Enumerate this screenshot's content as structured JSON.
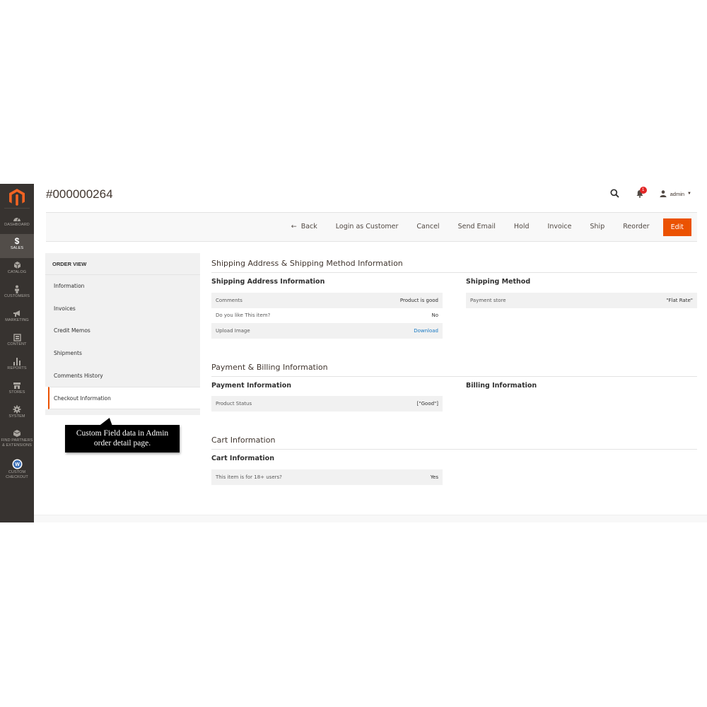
{
  "sidebar": {
    "items": [
      {
        "label": "DASHBOARD",
        "icon": "dashboard-icon"
      },
      {
        "label": "SALES",
        "icon": "dollar-icon",
        "active": true
      },
      {
        "label": "CATALOG",
        "icon": "cube-icon"
      },
      {
        "label": "CUSTOMERS",
        "icon": "person-icon"
      },
      {
        "label": "MARKETING",
        "icon": "megaphone-icon"
      },
      {
        "label": "CONTENT",
        "icon": "content-icon"
      },
      {
        "label": "REPORTS",
        "icon": "bar-chart-icon"
      },
      {
        "label": "STORES",
        "icon": "store-icon"
      },
      {
        "label": "SYSTEM",
        "icon": "gear-icon"
      },
      {
        "label_line1": "FIND PARTNERS",
        "label_line2": "& EXTENSIONS",
        "icon": "box-icon"
      },
      {
        "label_line1": "CUSTOM",
        "label_line2": "CHECKOUT",
        "icon": "w-logo-icon"
      }
    ]
  },
  "header": {
    "title": "#000000264",
    "notification_count": "1",
    "user": "admin"
  },
  "toolbar": {
    "back": "Back",
    "login_as_customer": "Login as Customer",
    "cancel": "Cancel",
    "send_email": "Send Email",
    "hold": "Hold",
    "invoice": "Invoice",
    "ship": "Ship",
    "reorder": "Reorder",
    "edit": "Edit"
  },
  "tabs": {
    "title": "ORDER VIEW",
    "items": [
      "Information",
      "Invoices",
      "Credit Memos",
      "Shipments",
      "Comments History",
      "Checkout Information"
    ]
  },
  "annotation": {
    "line1": "Custom Field data in Admin",
    "line2": "order detail page."
  },
  "shipping": {
    "section_title": "Shipping Address & Shipping Method Information",
    "address_title": "Shipping Address Information",
    "address_rows": [
      {
        "k": "Comments",
        "v": "Product is good"
      },
      {
        "k": "Do you like This item?",
        "v": "No"
      },
      {
        "k": "Upload Image",
        "v": "Download"
      }
    ],
    "method_title": "Shipping Method",
    "method_rows": [
      {
        "k": "Payment store",
        "v": "\"Flat Rate\""
      }
    ]
  },
  "payment": {
    "section_title": "Payment & Billing Information",
    "payment_title": "Payment Information",
    "payment_rows": [
      {
        "k": "Product Status",
        "v": "[\"Good\"]"
      }
    ],
    "billing_title": "Billing Information"
  },
  "cart": {
    "section_title": "Cart Information",
    "cart_title": "Cart Information",
    "cart_rows": [
      {
        "k": "This item is for 18+ users?",
        "v": "Yes"
      }
    ]
  },
  "colors": {
    "accent": "#eb5202",
    "sidebar_bg": "#373330",
    "link": "#1979c3"
  }
}
